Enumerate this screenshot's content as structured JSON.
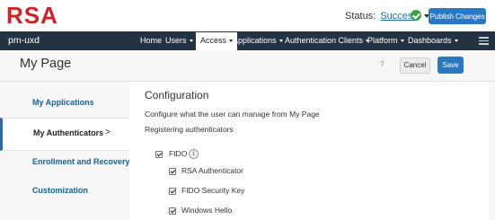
{
  "header": {
    "logo_text": "RSA",
    "status_label": "Status:",
    "status_value": "Success",
    "publish_label": "Publish Changes"
  },
  "navbar": {
    "brand": "pm-uxd",
    "items": [
      {
        "label": "Home",
        "has_menu": false
      },
      {
        "label": "Users",
        "has_menu": true
      },
      {
        "label": "Access",
        "has_menu": true,
        "active": true
      },
      {
        "label": "Applications",
        "has_menu": true
      },
      {
        "label": "Authentication Clients",
        "has_menu": true
      },
      {
        "label": "Platform",
        "has_menu": true
      },
      {
        "label": "Dashboards",
        "has_menu": true
      }
    ]
  },
  "page": {
    "title": "My Page",
    "help": "?",
    "cancel_label": "Cancel",
    "save_label": "Save"
  },
  "sidebar": {
    "items": [
      {
        "label": "My Applications"
      },
      {
        "label": "My Authenticators",
        "active": true,
        "chevron": ">"
      },
      {
        "label": "Enrollment and Recovery"
      },
      {
        "label": "Customization"
      }
    ]
  },
  "main": {
    "section_title": "Configuration",
    "description": "Configure what the user can manage from My Page",
    "subheading": "Registering authenticators",
    "parent_option": {
      "label": "FIDO",
      "checked": true,
      "info": "i"
    },
    "options": [
      {
        "label": "RSA Authenticator",
        "checked": true
      },
      {
        "label": "FIDO Security Key",
        "checked": true
      },
      {
        "label": "Windows Hello",
        "checked": true
      }
    ]
  },
  "colors": {
    "brand_red": "#d42027",
    "nav_bg": "#243342",
    "primary_blue": "#2b78c2",
    "link_blue": "#1a6194",
    "success_green": "#3aa23a"
  }
}
